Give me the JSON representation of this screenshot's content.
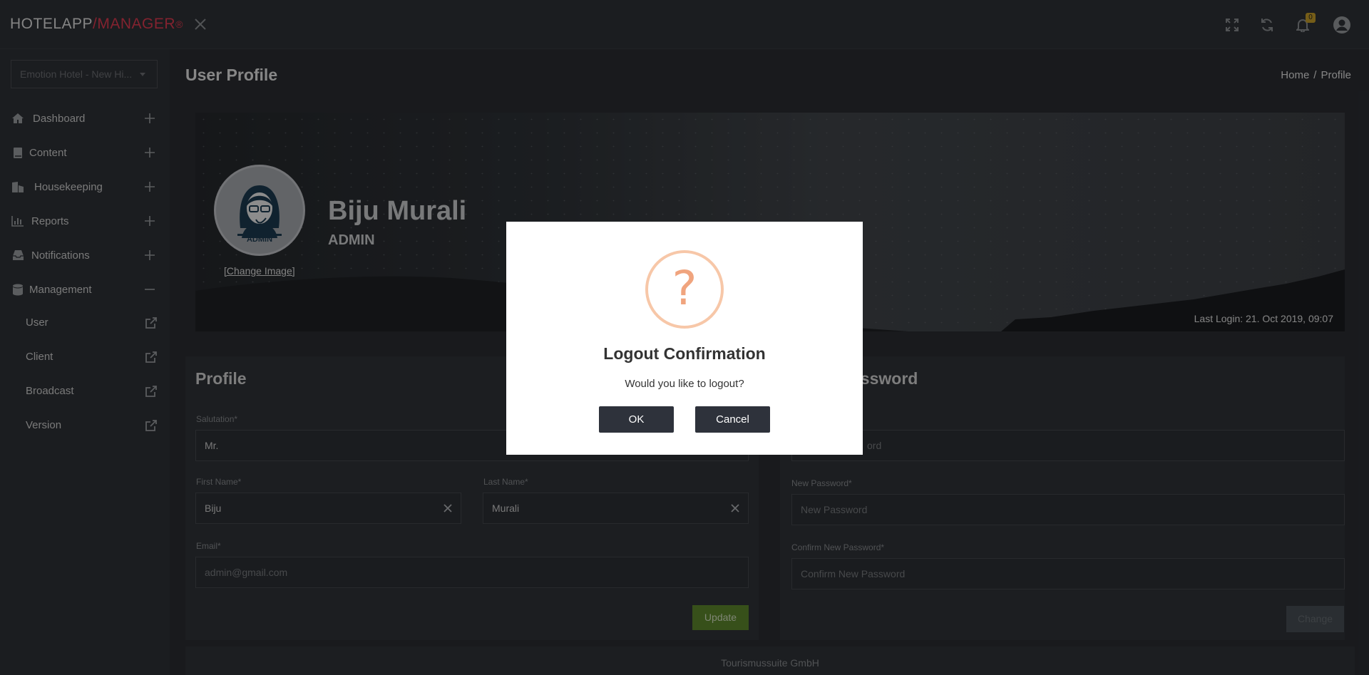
{
  "brand": {
    "part1": "HOTELAPP",
    "part2": "/MANAGER",
    "reg": "®"
  },
  "topbar": {
    "notification_count": "0"
  },
  "sidebar": {
    "hotel_select": "Emotion Hotel - New Hi...",
    "items": [
      {
        "label": "Dashboard",
        "icon": "home-icon",
        "toggle": "plus"
      },
      {
        "label": "Content",
        "icon": "book-icon",
        "toggle": "plus"
      },
      {
        "label": "Housekeeping",
        "icon": "building-icon",
        "toggle": "plus"
      },
      {
        "label": "Reports",
        "icon": "chart-icon",
        "toggle": "plus"
      },
      {
        "label": "Notifications",
        "icon": "inbox-icon",
        "toggle": "plus"
      },
      {
        "label": "Management",
        "icon": "database-icon",
        "toggle": "minus"
      }
    ],
    "sub_items": [
      {
        "label": "User"
      },
      {
        "label": "Client"
      },
      {
        "label": "Broadcast"
      },
      {
        "label": "Version"
      }
    ]
  },
  "page": {
    "title": "User Profile",
    "breadcrumb": {
      "home": "Home",
      "sep": "/",
      "current": "Profile"
    }
  },
  "banner": {
    "name": "Biju Murali",
    "role": "ADMIN",
    "avatar_text": "ADMIN",
    "change_image": "[Change Image]",
    "last_login": "Last Login: 21. Oct 2019, 09:07"
  },
  "profile": {
    "title": "Profile",
    "salutation_label": "Salutation*",
    "salutation_value": "Mr.",
    "first_name_label": "First Name*",
    "first_name_value": "Biju",
    "last_name_label": "Last Name*",
    "last_name_value": "Murali",
    "email_label": "Email*",
    "email_placeholder": "admin@gmail.com",
    "update_label": "Update"
  },
  "password": {
    "title_partial": "assword",
    "current_label_partial": "*",
    "current_placeholder_partial": "ord",
    "new_label": "New Password*",
    "new_placeholder": "New Password",
    "confirm_label": "Confirm New Password*",
    "confirm_placeholder": "Confirm New Password",
    "change_label": "Change"
  },
  "footer": {
    "text": "Tourismussuite GmbH"
  },
  "modal": {
    "icon": "question-icon",
    "title": "Logout Confirmation",
    "text": "Would you like to logout?",
    "ok": "OK",
    "cancel": "Cancel"
  },
  "colors": {
    "accent_red": "#e23c52",
    "update_green": "#5f8a2e",
    "modal_button": "#2e323b",
    "question_orange": "#f0a47e"
  }
}
